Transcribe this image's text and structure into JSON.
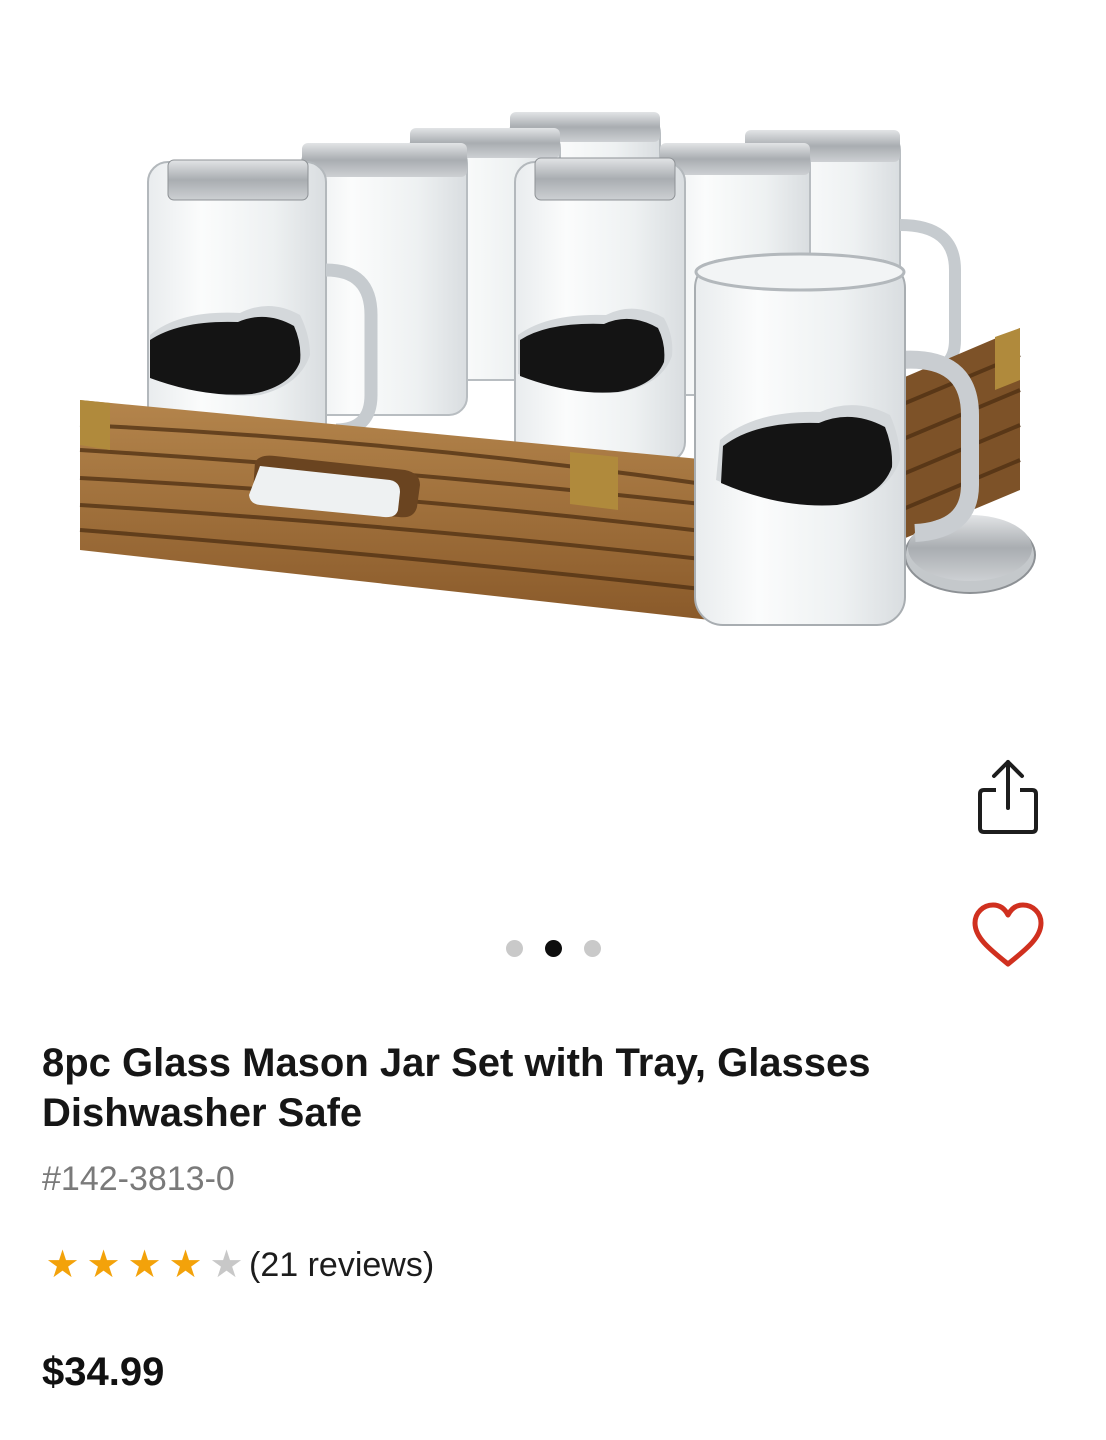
{
  "product": {
    "title": "8pc Glass Mason Jar Set with Tray, Glasses Dishwasher Safe",
    "sku": "#142-3813-0",
    "rating": 4,
    "rating_max": 5,
    "reviews_label": "(21 reviews)",
    "price": "$34.99"
  },
  "gallery": {
    "image_count": 3,
    "current_index": 2
  },
  "actions": {
    "share_icon": "share-icon",
    "favorite_icon": "heart-icon"
  },
  "colors": {
    "star": "#f3a20a",
    "star_off": "#c8c8c8",
    "heart": "#d0301f",
    "dot_active": "#0d0d0d",
    "dot_inactive": "#c9c9c9"
  }
}
